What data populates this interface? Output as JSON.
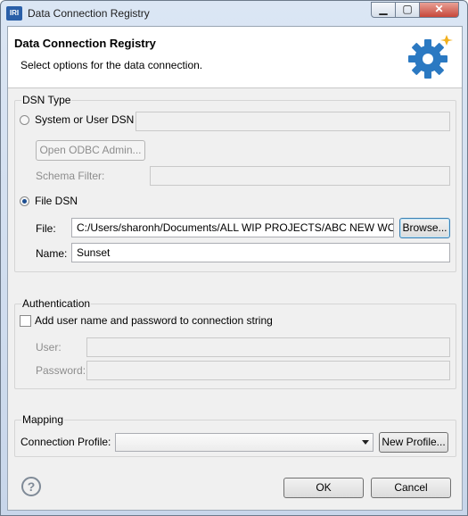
{
  "window": {
    "title": "Data Connection Registry",
    "app_icon_text": "IRI",
    "min_glyph": "▁",
    "max_glyph": "▢",
    "close_glyph": "✕"
  },
  "banner": {
    "title": "Data Connection Registry",
    "subtitle": "Select options for the data connection."
  },
  "dsn": {
    "group_label": "DSN Type",
    "system_label": "System or User DSN",
    "system_value": "",
    "open_odbc_label": "Open ODBC Admin...",
    "schema_filter_label": "Schema Filter:",
    "schema_filter_value": "",
    "file_dsn_label": "File DSN",
    "file_label": "File:",
    "file_value": "C:/Users/sharonh/Documents/ALL WIP PROJECTS/ABC NEW WORK",
    "browse_label": "Browse...",
    "name_label": "Name:",
    "name_value": "Sunset"
  },
  "auth": {
    "group_label": "Authentication",
    "checkbox_label": "Add user name and password to connection string",
    "user_label": "User:",
    "user_value": "",
    "password_label": "Password:",
    "password_value": ""
  },
  "mapping": {
    "group_label": "Mapping",
    "profile_label": "Connection Profile:",
    "profile_value": "",
    "new_profile_label": "New Profile..."
  },
  "footer": {
    "help_glyph": "?",
    "ok_label": "OK",
    "cancel_label": "Cancel"
  },
  "colors": {
    "accent": "#2a5fa8",
    "gear": "#2b79c2"
  }
}
